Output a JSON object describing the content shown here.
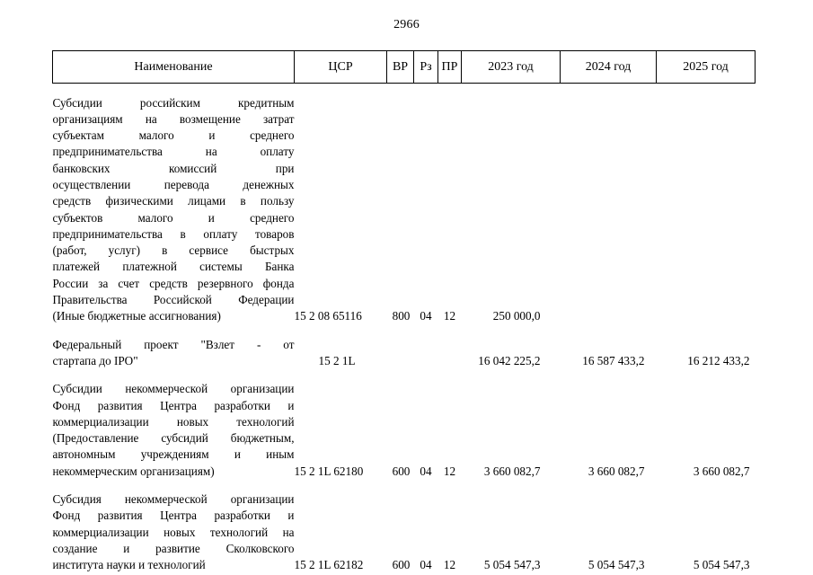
{
  "document": {
    "page_number": "2966"
  },
  "table": {
    "columns": [
      {
        "key": "name",
        "label": "Наименование"
      },
      {
        "key": "csr",
        "label": "ЦСР"
      },
      {
        "key": "vr",
        "label": "ВР"
      },
      {
        "key": "rz",
        "label": "Рз"
      },
      {
        "key": "pr",
        "label": "ПР"
      },
      {
        "key": "y2023",
        "label": "2023 год"
      },
      {
        "key": "y2024",
        "label": "2024 год"
      },
      {
        "key": "y2025",
        "label": "2025 год"
      }
    ],
    "rows": [
      {
        "name_lines": [
          "Субсидии российским кредитным",
          "организациям на возмещение затрат",
          "субъектам малого и среднего",
          "предпринимательства на оплату",
          "банковских комиссий при",
          "осуществлении перевода денежных",
          "средств физическими лицами в пользу",
          "субъектов малого и среднего",
          "предпринимательства в оплату товаров",
          "(работ, услуг) в сервисе быстрых",
          "платежей платежной системы Банка",
          "России за счет средств резервного фонда",
          "Правительства Российской Федерации",
          "(Иные бюджетные ассигнования)"
        ],
        "name_text": "Субсидии российским кредитным организациям на возмещение затрат субъектам малого и среднего предпринимательства на оплату банковских комиссий при осуществлении перевода денежных средств физическими лицами в пользу субъектов малого и среднего предпринимательства в оплату товаров (работ, услуг) в сервисе быстрых платежей платежной системы Банка России за счет средств резервного фонда Правительства Российской Федерации (Иные бюджетные ассигнования)",
        "csr": "15 2 08 65116",
        "vr": "800",
        "rz": "04",
        "pr": "12",
        "y2023": "250 000,0",
        "y2024": "",
        "y2025": ""
      },
      {
        "name_lines": [
          "Федеральный проект \"Взлет - от",
          "стартапа до IPO\""
        ],
        "name_text": "Федеральный проект \"Взлет - от стартапа до IPO\"",
        "csr": "15 2 1L",
        "vr": "",
        "rz": "",
        "pr": "",
        "y2023": "16 042 225,2",
        "y2024": "16 587 433,2",
        "y2025": "16 212 433,2"
      },
      {
        "name_lines": [
          "Субсидии некоммерческой организации",
          "Фонд развития Центра разработки и",
          "коммерциализации новых технологий",
          "(Предоставление субсидий бюджетным,",
          "автономным учреждениям и иным",
          "некоммерческим организациям)"
        ],
        "name_text": "Субсидии некоммерческой организации Фонд развития Центра разработки и коммерциализации новых технологий (Предоставление субсидий бюджетным, автономным учреждениям и иным некоммерческим организациям)",
        "csr": "15 2 1L 62180",
        "vr": "600",
        "rz": "04",
        "pr": "12",
        "y2023": "3 660 082,7",
        "y2024": "3 660 082,7",
        "y2025": "3 660 082,7"
      },
      {
        "name_lines": [
          "Субсидия некоммерческой организации",
          "Фонд развития Центра разработки и",
          "коммерциализации новых технологий на",
          "создание и развитие Сколковского",
          "института науки и технологий"
        ],
        "name_text": "Субсидия некоммерческой организации Фонд развития Центра разработки и коммерциализации новых технологий на создание и развитие Сколковского института науки и технологий",
        "csr": "15 2 1L 62182",
        "vr": "600",
        "rz": "04",
        "pr": "12",
        "y2023": "5 054 547,3",
        "y2024": "5 054 547,3",
        "y2025": "5 054 547,3"
      }
    ]
  }
}
